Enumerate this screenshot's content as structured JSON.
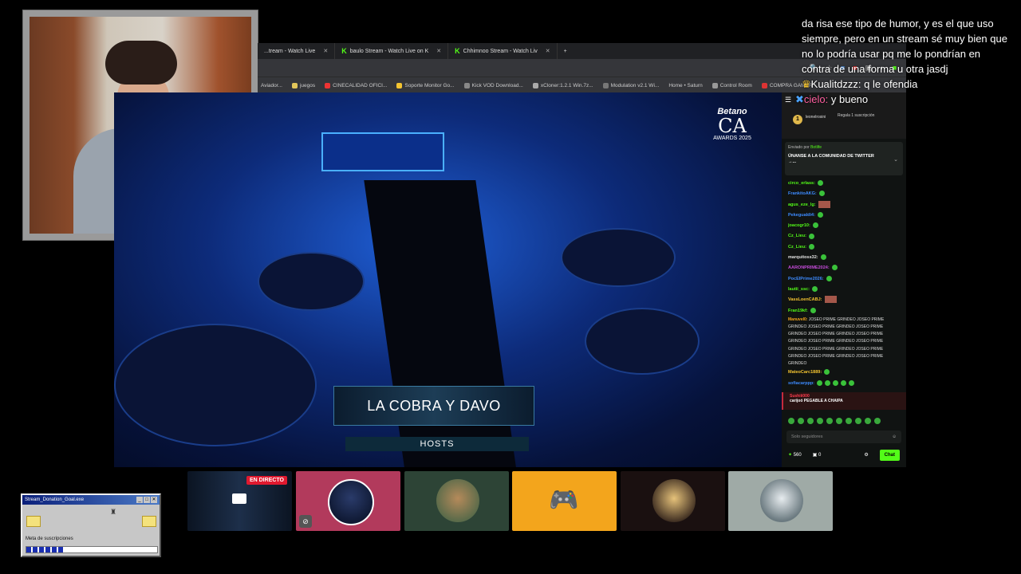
{
  "browser": {
    "tabs": [
      {
        "label": "...tream - Watch Live"
      },
      {
        "label": "baulo Stream - Watch Live on K"
      },
      {
        "label": "Chhimnoo Stream - Watch Liv"
      }
    ],
    "new_tab": "+",
    "bookmarks": [
      "Aviador...",
      "juegos",
      "CINECALIDAD OFICI...",
      "Soporte Monitor Go...",
      "Kick VOD Download...",
      "xCloner:1.2.1 Win.7z...",
      "Modulation v2.1 Wi...",
      "Home • Saturn",
      "Control Room",
      "COMPRA GAMER"
    ]
  },
  "video": {
    "logo_brand": "Betano",
    "logo_text": "CA",
    "logo_sub": "AWARDS 2025",
    "lower_third_names": "LA COBRA Y DAVO",
    "lower_third_sub": "HOSTS"
  },
  "overlay_chat": {
    "line1": "da risa ese tipo de humor, y es el que uso siempre, pero en un stream sé muy bien que no lo podría usar pq me lo pondrían en contra de una forma u otra jasdj",
    "line2_user": "Kualitdzzz:",
    "line2_text": " q le ofendia",
    "line3_user": "cielo:",
    "line3_text": " y bueno"
  },
  "chat": {
    "header_badge": "1",
    "header_user": "leonelrosini",
    "header_regala": "Regala 1 suscripción",
    "pinned_by": "Enviado por",
    "pinned_by_user": "Botlife",
    "pinned_msg": "ÚNANSE A LA COMUNIDAD DE TWITTER →...",
    "messages": [
      {
        "user": "circo_erlass:",
        "color": "#53fc18"
      },
      {
        "user": "FrankitoAKG:",
        "color": "#3d8bff"
      },
      {
        "user": "agus_eze_lg:",
        "color": "#53fc18"
      },
      {
        "user": "Pekegualdi4:",
        "color": "#3d8bff"
      },
      {
        "user": "joacogr10:",
        "color": "#53fc18"
      },
      {
        "user": "Cz_Lieu:",
        "color": "#53fc18"
      },
      {
        "user": "Cz_Lieu:",
        "color": "#53fc18"
      },
      {
        "user": "marquitoss32:",
        "color": "#e0e0e0"
      },
      {
        "user": "AARONPRIME2024:",
        "color": "#c44bd8"
      },
      {
        "user": "PocElPrime2026:",
        "color": "#3d8bff"
      },
      {
        "user": "lautii_ssc:",
        "color": "#53fc18"
      },
      {
        "user": "VassLoenCABJ:",
        "color": "#f4c430"
      },
      {
        "user": "Fran19kf:",
        "color": "#53fc18"
      }
    ],
    "spam_user": "Manuvel0:",
    "spam_text": "JOSEO PRIME GRINDEO JOSEO PRIME GRINDEO JOSEO PRIME GRINDEO JOSEO PRIME GRINDEO JOSEO PRIME GRINDEO JOSEO PRIME GRINDEO JOSEO PRIME GRINDEO JOSEO PRIME GRINDEO JOSEO PRIME GRINDEO JOSEO PRIME GRINDEO JOSEO PRIME GRINDEO JOSEO PRIME GRINDEO",
    "msg_after1": "MateoCarc1889:",
    "msg_after2": "sofiacarppp:",
    "highlight_user": "Sushiii000",
    "highlight_text": "carijoó PEGABLE A CHAIPA",
    "input_placeholder": "Solo seguidores",
    "points": "560",
    "gifts": "0",
    "chat_button": "Chat"
  },
  "cards": {
    "live_badge": "EN DIRECTO"
  },
  "donation": {
    "title": "Stream_Donation_Goal.exe",
    "label": "Meta de suscripciones",
    "progress": 0.28
  }
}
